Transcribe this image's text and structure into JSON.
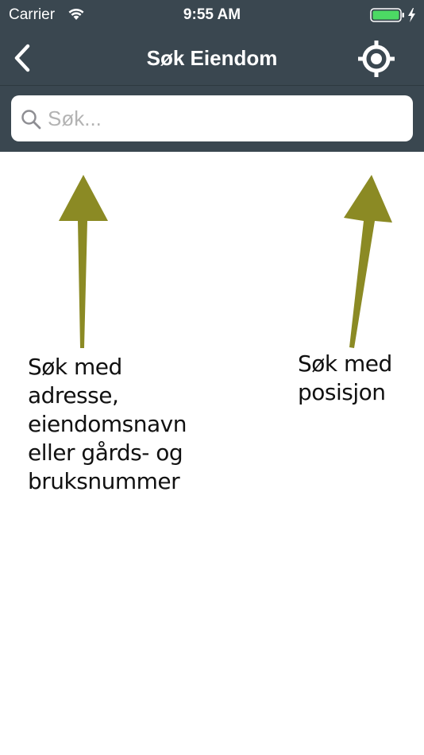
{
  "status_bar": {
    "carrier": "Carrier",
    "time": "9:55 AM",
    "battery_color": "#4cd964",
    "icons": [
      "wifi-icon",
      "battery-icon",
      "charging-icon"
    ]
  },
  "nav": {
    "title": "Søk Eiendom",
    "back_icon": "chevron-left-icon",
    "locate_icon": "crosshair-icon"
  },
  "search": {
    "placeholder": "Søk...",
    "value": "",
    "icon": "search-icon"
  },
  "hints": {
    "address_lines": [
      "Søk med",
      "adresse,",
      "eiendomsnavn",
      "eller gårds- og",
      "bruksnummer"
    ],
    "position_lines": [
      "Søk med",
      "posisjon"
    ],
    "arrow_color": "#8b8a24"
  },
  "colors": {
    "header_bg": "#3a4750",
    "page_bg": "#ffffff"
  }
}
